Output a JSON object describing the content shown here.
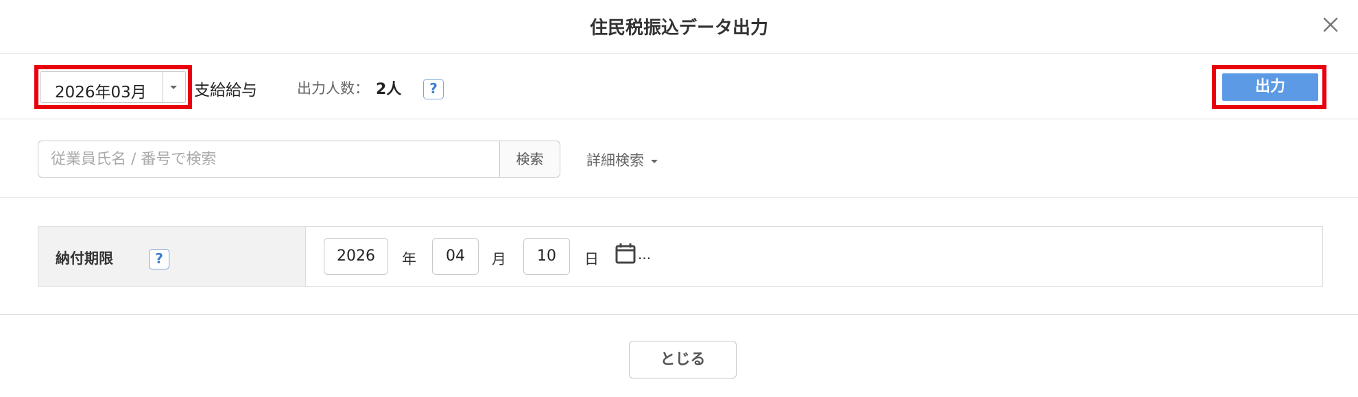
{
  "dialog": {
    "title": "住民税振込データ出力",
    "close_icon": "close-icon"
  },
  "toolbar": {
    "period_value": "2026年03月",
    "pay_type": "支給給与",
    "count_label": "出力人数：",
    "count_value": "2人",
    "help_text": "?",
    "export_label": "出力"
  },
  "search": {
    "placeholder": "従業員氏名 / 番号で検索",
    "value": "",
    "button_label": "検索",
    "advanced_label": "詳細検索"
  },
  "deadline": {
    "label": "納付期限",
    "help_text": "?",
    "year": "2026",
    "year_unit": "年",
    "month": "04",
    "month_unit": "月",
    "day": "10",
    "day_unit": "日",
    "calendar_icon": "calendar-icon",
    "ellipsis": "..."
  },
  "footer": {
    "close_label": "とじる"
  },
  "colors": {
    "accent": "#5c9ae6",
    "highlight": "#e8000d",
    "label_background": "#f2f2f2"
  }
}
